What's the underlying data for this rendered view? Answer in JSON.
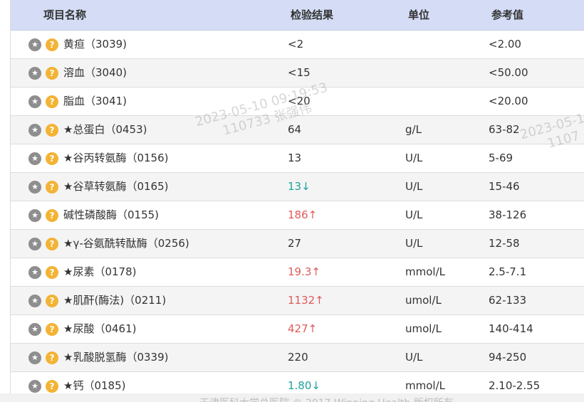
{
  "header": {
    "col_name": "项目名称",
    "col_result": "检验结果",
    "col_unit": "单位",
    "col_ref": "参考值"
  },
  "icons": {
    "star": "star-icon",
    "help": "question-icon",
    "star_glyph": "★",
    "help_glyph": "?"
  },
  "colors": {
    "header_bg": "#d4ddf5",
    "high": "#e05a5a",
    "low": "#1ea39a",
    "star_btn": "#8e8e8e",
    "help_btn": "#f3b334"
  },
  "rows": [
    {
      "name": "黄疸（3039)",
      "result": "<2",
      "flag": "",
      "unit": "",
      "ref": "<2.00"
    },
    {
      "name": "溶血（3040)",
      "result": "<15",
      "flag": "",
      "unit": "",
      "ref": "<50.00"
    },
    {
      "name": "脂血（3041)",
      "result": "<20",
      "flag": "",
      "unit": "",
      "ref": "<20.00"
    },
    {
      "name": "★总蛋白（0453)",
      "result": "64",
      "flag": "",
      "unit": "g/L",
      "ref": "63-82"
    },
    {
      "name": "★谷丙转氨酶（0156)",
      "result": "13",
      "flag": "",
      "unit": "U/L",
      "ref": "5-69"
    },
    {
      "name": "★谷草转氨酶（0165)",
      "result": "13↓",
      "flag": "low",
      "unit": "U/L",
      "ref": "15-46"
    },
    {
      "name": "碱性磷酸酶（0155)",
      "result": "186↑",
      "flag": "high",
      "unit": "U/L",
      "ref": "38-126"
    },
    {
      "name": "★γ-谷氨酰转酞酶（0256)",
      "result": "27",
      "flag": "",
      "unit": "U/L",
      "ref": "12-58"
    },
    {
      "name": "★尿素（0178)",
      "result": "19.3↑",
      "flag": "high",
      "unit": "mmol/L",
      "ref": "2.5-7.1"
    },
    {
      "name": "★肌酐(酶法)（0211)",
      "result": "1132↑",
      "flag": "high",
      "unit": "umol/L",
      "ref": "62-133"
    },
    {
      "name": "★尿酸（0461)",
      "result": "427↑",
      "flag": "high",
      "unit": "umol/L",
      "ref": "140-414"
    },
    {
      "name": "★乳酸脱氢酶（0339)",
      "result": "220",
      "flag": "",
      "unit": "U/L",
      "ref": "94-250"
    },
    {
      "name": "★钙（0185)",
      "result": "1.80↓",
      "flag": "low",
      "unit": "mmol/L",
      "ref": "2.10-2.55"
    }
  ],
  "watermark": {
    "line1": "2023-05-10 09:19:53",
    "line2": "110733 张强伟",
    "line1_b": "2023-05-1",
    "line2_b": "1107"
  },
  "footer": {
    "text": "天津医科大学总医院 © 2017 Winning Health 版权所有"
  }
}
